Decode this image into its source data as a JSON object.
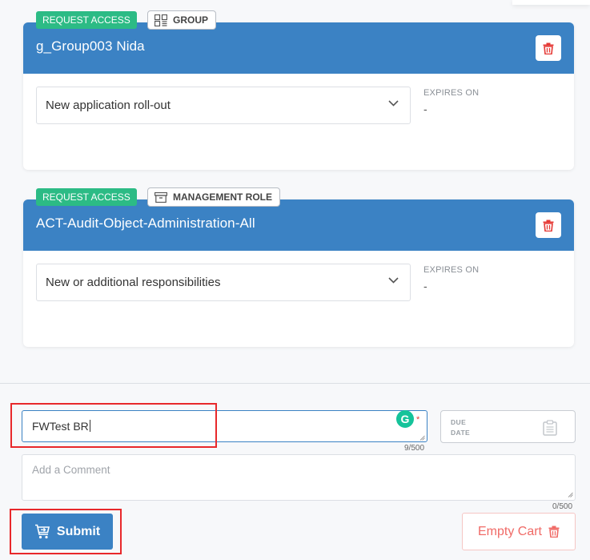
{
  "cart_items": [
    {
      "request_badge": "REQUEST ACCESS",
      "type_label": "GROUP",
      "type_icon": "group-icon",
      "title": "g_Group003 Nida",
      "reason_selected": "New application roll-out",
      "expires_label": "EXPIRES ON",
      "expires_value": "-"
    },
    {
      "request_badge": "REQUEST ACCESS",
      "type_label": "MANAGEMENT ROLE",
      "type_icon": "archive-box-icon",
      "title": "ACT-Audit-Object-Administration-All",
      "reason_selected": "New or additional responsibilities",
      "expires_label": "EXPIRES ON",
      "expires_value": "-"
    }
  ],
  "form": {
    "justification_value": "FWTest BR",
    "justification_counter": "9/500",
    "required_marker": "*",
    "grammarly_letter": "G",
    "due_date_line1": "DUE",
    "due_date_line2": "DATE",
    "comment_placeholder": "Add a Comment",
    "comment_counter": "0/500"
  },
  "actions": {
    "submit_label": "Submit",
    "empty_cart_label": "Empty Cart"
  },
  "colors": {
    "header_blue": "#3b82c4",
    "badge_green": "#2cbb85",
    "danger_red": "#e53935",
    "highlight_red": "#e8282b"
  }
}
